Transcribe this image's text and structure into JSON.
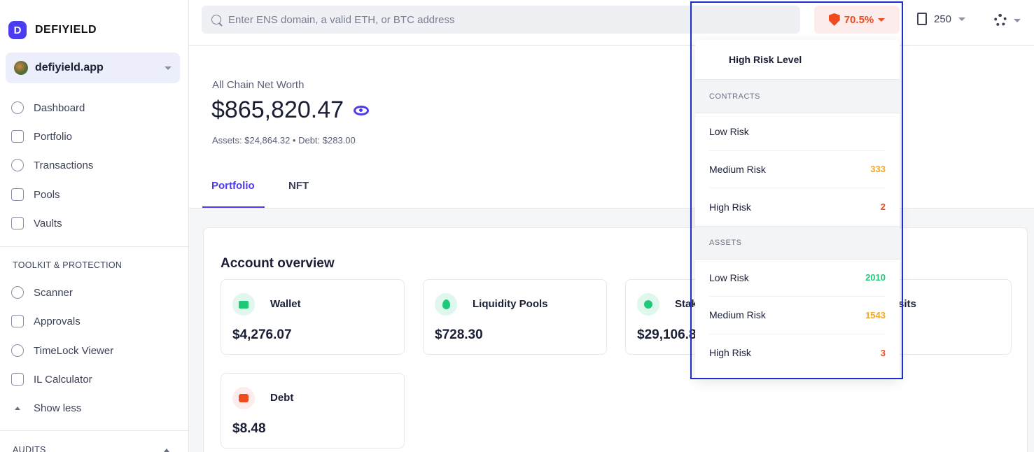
{
  "brand": {
    "name": "DEFIYIELD",
    "logo_letter": "D"
  },
  "account": {
    "name": "defiyield.app"
  },
  "sidebar": {
    "items": [
      {
        "label": "Dashboard",
        "icon": "dashboard-icon"
      },
      {
        "label": "Portfolio",
        "icon": "portfolio-icon"
      },
      {
        "label": "Transactions",
        "icon": "transactions-icon"
      },
      {
        "label": "Pools",
        "icon": "pools-icon"
      },
      {
        "label": "Vaults",
        "icon": "vaults-icon"
      }
    ],
    "toolkit_title": "TOOLKIT & PROTECTION",
    "toolkit_items": [
      {
        "label": "Scanner",
        "icon": "scanner-icon"
      },
      {
        "label": "Approvals",
        "icon": "approvals-icon"
      },
      {
        "label": "TimeLock Viewer",
        "icon": "timelock-icon"
      },
      {
        "label": "IL Calculator",
        "icon": "calculator-icon"
      }
    ],
    "show_less": "Show less",
    "audits_title": "AUDITS"
  },
  "topbar": {
    "search_placeholder": "Enter ENS domain, a valid ETH, or BTC address",
    "risk_percent": "70.5%",
    "gas_value": "250"
  },
  "networth": {
    "label": "All Chain Net Worth",
    "value": "$865,820.47",
    "sub": "Assets: $24,864.32  •  Debt: $283.00"
  },
  "tabs": [
    {
      "label": "Portfolio"
    },
    {
      "label": "NFT"
    }
  ],
  "overview": {
    "title": "Account overview",
    "cards": [
      {
        "name": "Wallet",
        "value": "$4,276.07"
      },
      {
        "name": "Liquidity Pools",
        "value": "$728.30"
      },
      {
        "name": "Stak",
        "value": "$29,106.8"
      },
      {
        "name": "sits",
        "value": ""
      },
      {
        "name": "Debt",
        "value": "$8.48"
      }
    ]
  },
  "risk_dropdown": {
    "title": "High Risk Level",
    "contracts_label": "CONTRACTS",
    "contracts": [
      {
        "label": "Low Risk",
        "value": ""
      },
      {
        "label": "Medium Risk",
        "value": "333"
      },
      {
        "label": "High Risk",
        "value": "2"
      }
    ],
    "assets_label": "ASSETS",
    "assets": [
      {
        "label": "Low Risk",
        "value": "2010"
      },
      {
        "label": "Medium Risk",
        "value": "1543"
      },
      {
        "label": "High Risk",
        "value": "3"
      }
    ],
    "colors": {
      "low": "#1fc97a",
      "medium": "#f5a623",
      "high": "#f04b1e"
    }
  }
}
